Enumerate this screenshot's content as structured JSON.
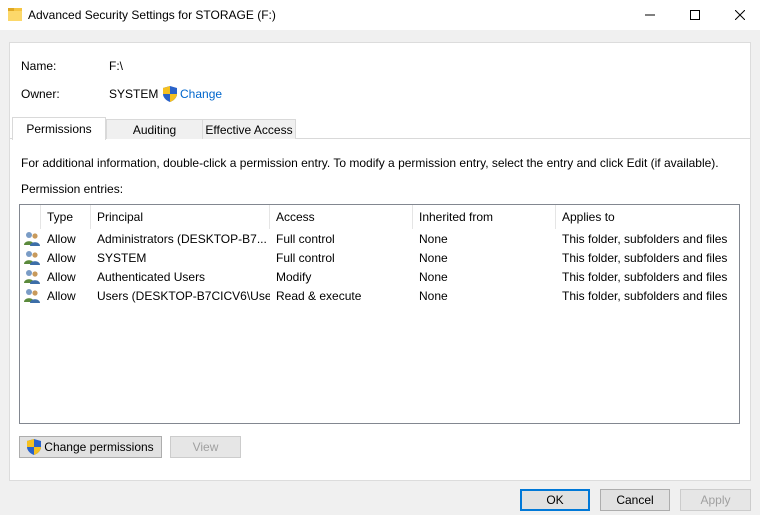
{
  "window": {
    "title": "Advanced Security Settings for STORAGE (F:)",
    "controls": {
      "minimize": "minimize",
      "maximize": "maximize",
      "close": "close"
    }
  },
  "header": {
    "name_label": "Name:",
    "name_value": "F:\\",
    "owner_label": "Owner:",
    "owner_value": "SYSTEM",
    "change_link": "Change"
  },
  "tabs": [
    {
      "label": "Permissions",
      "active": true
    },
    {
      "label": "Auditing",
      "active": false
    },
    {
      "label": "Effective Access",
      "active": false
    }
  ],
  "permissions": {
    "info_text": "For additional information, double-click a permission entry. To modify a permission entry, select the entry and click Edit (if available).",
    "entries_label": "Permission entries:",
    "columns": [
      "Type",
      "Principal",
      "Access",
      "Inherited from",
      "Applies to"
    ],
    "rows": [
      {
        "type": "Allow",
        "principal": "Administrators (DESKTOP-B7...",
        "access": "Full control",
        "inherited_from": "None",
        "applies_to": "This folder, subfolders and files"
      },
      {
        "type": "Allow",
        "principal": "SYSTEM",
        "access": "Full control",
        "inherited_from": "None",
        "applies_to": "This folder, subfolders and files"
      },
      {
        "type": "Allow",
        "principal": "Authenticated Users",
        "access": "Modify",
        "inherited_from": "None",
        "applies_to": "This folder, subfolders and files"
      },
      {
        "type": "Allow",
        "principal": "Users (DESKTOP-B7CICV6\\Use...",
        "access": "Read & execute",
        "inherited_from": "None",
        "applies_to": "This folder, subfolders and files"
      }
    ],
    "change_permissions_button": "Change permissions",
    "view_button": "View"
  },
  "dialog_buttons": {
    "ok": "OK",
    "cancel": "Cancel",
    "apply": "Apply"
  },
  "colors": {
    "link": "#0066cc",
    "accent": "#0078d7",
    "disabled_text": "#a0a0a0"
  },
  "icons": [
    "folder-icon",
    "uac-shield-icon",
    "users-icon"
  ]
}
